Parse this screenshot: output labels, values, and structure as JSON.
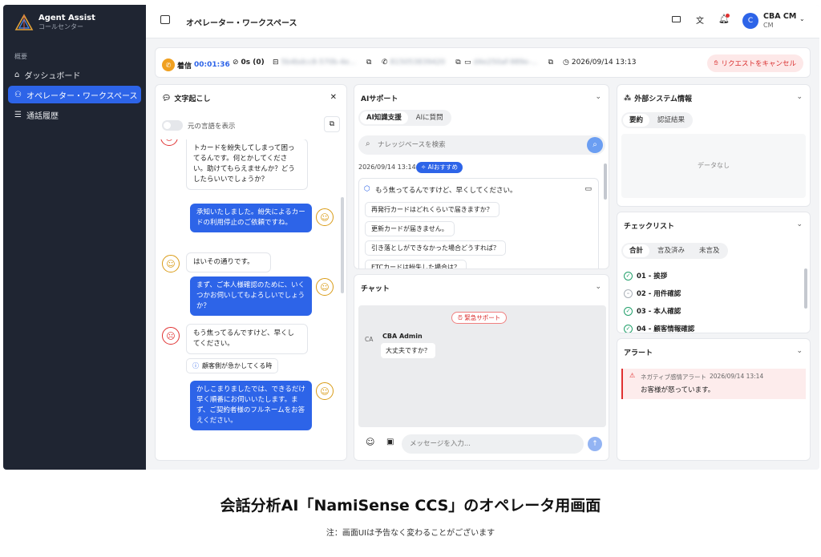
{
  "sidebar": {
    "brand_title": "Agent Assist",
    "brand_sub": "コールセンター",
    "section": "概要",
    "items": [
      {
        "label": "ダッシュボード"
      },
      {
        "label": "オペレーター・ワークスペース"
      },
      {
        "label": "通話履歴"
      }
    ]
  },
  "topbar": {
    "title": "オペレーター・ワークスペース",
    "user_avatar": "C",
    "user_name": "CBA CM",
    "user_initials": "CM"
  },
  "call": {
    "status": "着信",
    "duration": "00:01:36",
    "hold": "0s (0)",
    "call_id": "5b4bdcc8-570b-4e...",
    "phone": "815053839420",
    "device_id": "d4e250af-989e-...",
    "datetime": "2026/09/14 13:13",
    "cancel": "リクエストをキャンセル"
  },
  "transcript": {
    "title": "文字起こし",
    "toggle_label": "元の言語を表示",
    "messages": [
      {
        "role": "customer",
        "text": "トカードを紛失してしまって困ってるんです。何とかしてください。助けてもらえませんか？どうしたらいいでしょうか？"
      },
      {
        "role": "operator",
        "text": "承知いたしました。紛失によるカードの利用停止のご依頼ですね。"
      },
      {
        "role": "customer",
        "text": "はいその通りです。"
      },
      {
        "role": "operator",
        "text": "まず、ご本人様確認のために、いくつかお伺いしてもよろしいでしょうか？"
      },
      {
        "role": "customer",
        "text": "もう焦ってるんですけど、早くしてください。"
      },
      {
        "role": "operator",
        "text": "かしこまりましたでは、できるだけ早く順番にお伺いいたします。まず、ご契約者様のフルネームをお答えください。"
      }
    ],
    "alert_chip": "顧客側が急かしてくる時"
  },
  "ai": {
    "title": "AIサポート",
    "tabs": [
      "AI知識支援",
      "AIに質問"
    ],
    "search_placeholder": "ナレッジベースを検索",
    "timestamp": "2026/09/14 13:14",
    "badge": "AIおすすめ",
    "question": "もう焦ってるんですけど、早くしてください。",
    "suggestions": [
      "再発行カードはどれくらいで届きますか？",
      "更新カードが届きません。",
      "引き落としができなかった場合どうすれば？",
      "ETCカードは紛失した場合は？"
    ]
  },
  "chat": {
    "title": "チャット",
    "urgent": "緊急サポート",
    "sender_initials": "CA",
    "sender": "CBA Admin",
    "message": "大丈夫ですか？",
    "input_placeholder": "メッセージを入力..."
  },
  "external": {
    "title": "外部システム情報",
    "tabs": [
      "要約",
      "認証結果"
    ],
    "empty": "データなし"
  },
  "checklist": {
    "title": "チェックリスト",
    "tabs": [
      "合計",
      "言及済み",
      "未言及"
    ],
    "items": [
      {
        "label": "01 - 挨拶",
        "done": true
      },
      {
        "label": "02 - 用件確認",
        "done": false
      },
      {
        "label": "03 - 本人確認",
        "done": true
      },
      {
        "label": "04 - 顧客情報確認",
        "done": true
      }
    ]
  },
  "alerts": {
    "title": "アラート",
    "type": "ネガティブ感情アラート",
    "time": "2026/09/14 13:14",
    "message": "お客様が怒っています。"
  },
  "caption": {
    "title": "会話分析AI「NamiSense CCS」のオペレータ用画面",
    "note": "注：画面UIは予告なく変わることがございます"
  },
  "colors": {
    "primary": "#2d64e8",
    "sidebar_bg": "#1f2532",
    "alert_red": "#e03131",
    "warn_yellow": "#d99b16",
    "success": "#22a06b"
  }
}
